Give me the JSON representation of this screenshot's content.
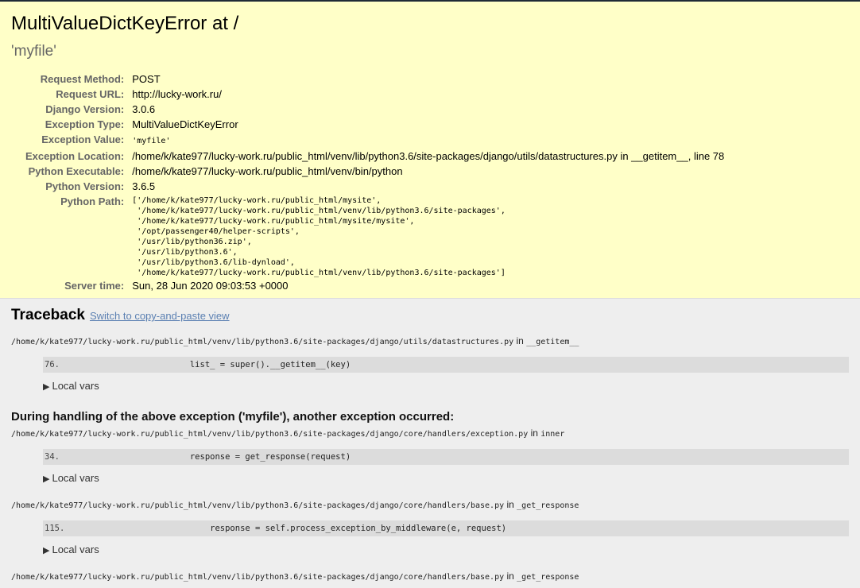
{
  "title": "MultiValueDictKeyError at /",
  "exception_value_header": "'myfile'",
  "meta": {
    "request_method_label": "Request Method:",
    "request_method": "POST",
    "request_url_label": "Request URL:",
    "request_url": "http://lucky-work.ru/",
    "django_version_label": "Django Version:",
    "django_version": "3.0.6",
    "exception_type_label": "Exception Type:",
    "exception_type": "MultiValueDictKeyError",
    "exception_value_label": "Exception Value:",
    "exception_value": "'myfile'",
    "exception_location_label": "Exception Location:",
    "exception_location": "/home/k/kate977/lucky-work.ru/public_html/venv/lib/python3.6/site-packages/django/utils/datastructures.py in __getitem__, line 78",
    "python_executable_label": "Python Executable:",
    "python_executable": "/home/k/kate977/lucky-work.ru/public_html/venv/bin/python",
    "python_version_label": "Python Version:",
    "python_version": "3.6.5",
    "python_path_label": "Python Path:",
    "python_path": "['/home/k/kate977/lucky-work.ru/public_html/mysite',\n '/home/k/kate977/lucky-work.ru/public_html/venv/lib/python3.6/site-packages',\n '/home/k/kate977/lucky-work.ru/public_html/mysite/mysite',\n '/opt/passenger40/helper-scripts',\n '/usr/lib/python36.zip',\n '/usr/lib/python3.6',\n '/usr/lib/python3.6/lib-dynload',\n '/home/k/kate977/lucky-work.ru/public_html/venv/lib/python3.6/site-packages']",
    "server_time_label": "Server time:",
    "server_time": "Sun, 28 Jun 2020 09:03:53 +0000"
  },
  "traceback": {
    "title": "Traceback",
    "switch_link": "Switch to copy-and-paste view",
    "local_vars_label": "Local vars",
    "cause_text": "During handling of the above exception ('myfile'), another exception occurred:",
    "in_word": "in",
    "frames": [
      {
        "file": "/home/k/kate977/lucky-work.ru/public_html/venv/lib/python3.6/site-packages/django/utils/datastructures.py",
        "func": "__getitem__",
        "lineno": "76.",
        "code": "            list_ = super().__getitem__(key)"
      },
      {
        "file": "/home/k/kate977/lucky-work.ru/public_html/venv/lib/python3.6/site-packages/django/core/handlers/exception.py",
        "func": "inner",
        "lineno": "34.",
        "code": "            response = get_response(request)"
      },
      {
        "file": "/home/k/kate977/lucky-work.ru/public_html/venv/lib/python3.6/site-packages/django/core/handlers/base.py",
        "func": "_get_response",
        "lineno": "115.",
        "code": "                response = self.process_exception_by_middleware(e, request)"
      },
      {
        "file": "/home/k/kate977/lucky-work.ru/public_html/venv/lib/python3.6/site-packages/django/core/handlers/base.py",
        "func": "_get_response"
      }
    ]
  }
}
